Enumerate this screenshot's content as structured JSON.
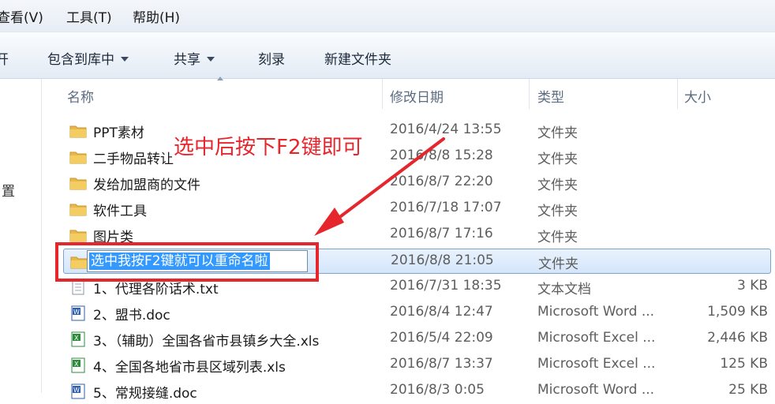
{
  "menu": {
    "view": "查看(V)",
    "tools": "工具(T)",
    "help": "帮助(H)"
  },
  "toolbar": {
    "open_fragment": "开",
    "include_library": "包含到库中",
    "share": "共享",
    "burn": "刻录",
    "new_folder": "新建文件夹"
  },
  "left_pane": {
    "item_fragment": "置"
  },
  "columns": {
    "name": "名称",
    "date": "修改日期",
    "type": "类型",
    "size": "大小"
  },
  "annotation": "选中后按下F2键即可",
  "rename_text": "选中我按F2键就可以重命名啦",
  "accent_colors": {
    "annotation_red": "#e5262c",
    "selection_blue": "#3399ff",
    "folder_yellow": "#e8b94a"
  },
  "files": [
    {
      "name": "PPT素材",
      "date": "2016/4/24 13:55",
      "type": "文件夹",
      "size": "",
      "icon": "folder-icon"
    },
    {
      "name": "二手物品转让",
      "date": "2016/8/8 15:28",
      "type": "文件夹",
      "size": "",
      "icon": "folder-icon"
    },
    {
      "name": "发给加盟商的文件",
      "date": "2016/8/7 22:20",
      "type": "文件夹",
      "size": "",
      "icon": "folder-icon"
    },
    {
      "name": "软件工具",
      "date": "2016/7/18 17:07",
      "type": "文件夹",
      "size": "",
      "icon": "folder-icon"
    },
    {
      "name": "图片类",
      "date": "2016/8/7 17:16",
      "type": "文件夹",
      "size": "",
      "icon": "folder-icon"
    },
    {
      "name": "",
      "date": "2016/8/8 21:05",
      "type": "文件夹",
      "size": "",
      "icon": "folder-icon",
      "selected": true
    },
    {
      "name": "1、代理各阶话术.txt",
      "date": "2016/7/31 18:35",
      "type": "文本文档",
      "size": "3 KB",
      "icon": "text-file-icon"
    },
    {
      "name": "2、盟书.doc",
      "date": "2016/8/4 12:47",
      "type": "Microsoft Word ...",
      "size": "1,509 KB",
      "icon": "word-doc-icon"
    },
    {
      "name": "3、（辅助）全国各省市县镇乡大全.xls",
      "date": "2016/5/4 22:09",
      "type": "Microsoft Excel ...",
      "size": "2,446 KB",
      "icon": "excel-sheet-icon"
    },
    {
      "name": "4、全国各地省市县区域列表.xls",
      "date": "2016/8/7 13:37",
      "type": "Microsoft Excel ...",
      "size": "125 KB",
      "icon": "excel-sheet-icon"
    },
    {
      "name": "5、常规接缝.doc",
      "date": "2016/8/3 0:05",
      "type": "Microsoft Word ...",
      "size": "25 KB",
      "icon": "word-doc-icon"
    }
  ]
}
